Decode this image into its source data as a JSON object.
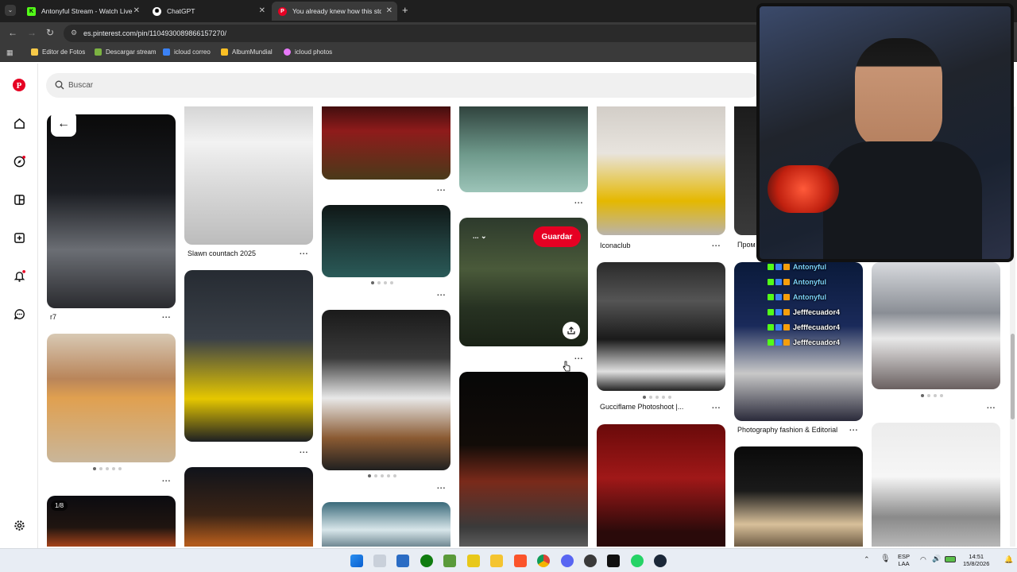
{
  "browser": {
    "tabs": [
      {
        "label": "Antonyful Stream - Watch Live",
        "favicon": "kick-icon",
        "color": "#53fc18"
      },
      {
        "label": "ChatGPT",
        "favicon": "chatgpt-icon",
        "color": "#ffffff"
      },
      {
        "label": "You already knew how this stor",
        "favicon": "pinterest-icon",
        "color": "#e60023"
      }
    ],
    "url": "es.pinterest.com/pin/1104930089866157270/",
    "bookmarks": [
      {
        "label": "Editor de Fotos",
        "color": "#f7c948"
      },
      {
        "label": "Descargar stream",
        "color": "#7cb342"
      },
      {
        "label": "icloud correo",
        "color": "#3b82f6"
      },
      {
        "label": "AlbumMundial",
        "color": "#fbbf24"
      },
      {
        "label": "icloud photos",
        "color": "#e879f9"
      }
    ]
  },
  "search": {
    "placeholder": "Buscar"
  },
  "pins": {
    "r7": "r7",
    "slawn": "Slawn countach 2025",
    "iconaclub": "Iconaclub",
    "prom": "Пром",
    "gucci": "Gucciflame Photoshoot |...",
    "photo": "Photography fashion & Editorial",
    "counter": "1/8",
    "more": "..."
  },
  "guardar": "Guardar",
  "chat": [
    {
      "user": "Antonyful",
      "color": "#7dd3fc"
    },
    {
      "user": "Antonyful",
      "color": "#7dd3fc"
    },
    {
      "user": "Antonyful",
      "color": "#7dd3fc"
    },
    {
      "user": "Jefffecuador4",
      "color": "#ffffff"
    },
    {
      "user": "Jefffecuador4",
      "color": "#ffffff"
    },
    {
      "user": "Jefffecuador4",
      "color": "#ffffff"
    }
  ],
  "tray": {
    "lang1": "ESP",
    "lang2": "LAA",
    "time": "14:51",
    "date": "15/8/2026"
  },
  "colors": {
    "brand": "#e60023"
  }
}
